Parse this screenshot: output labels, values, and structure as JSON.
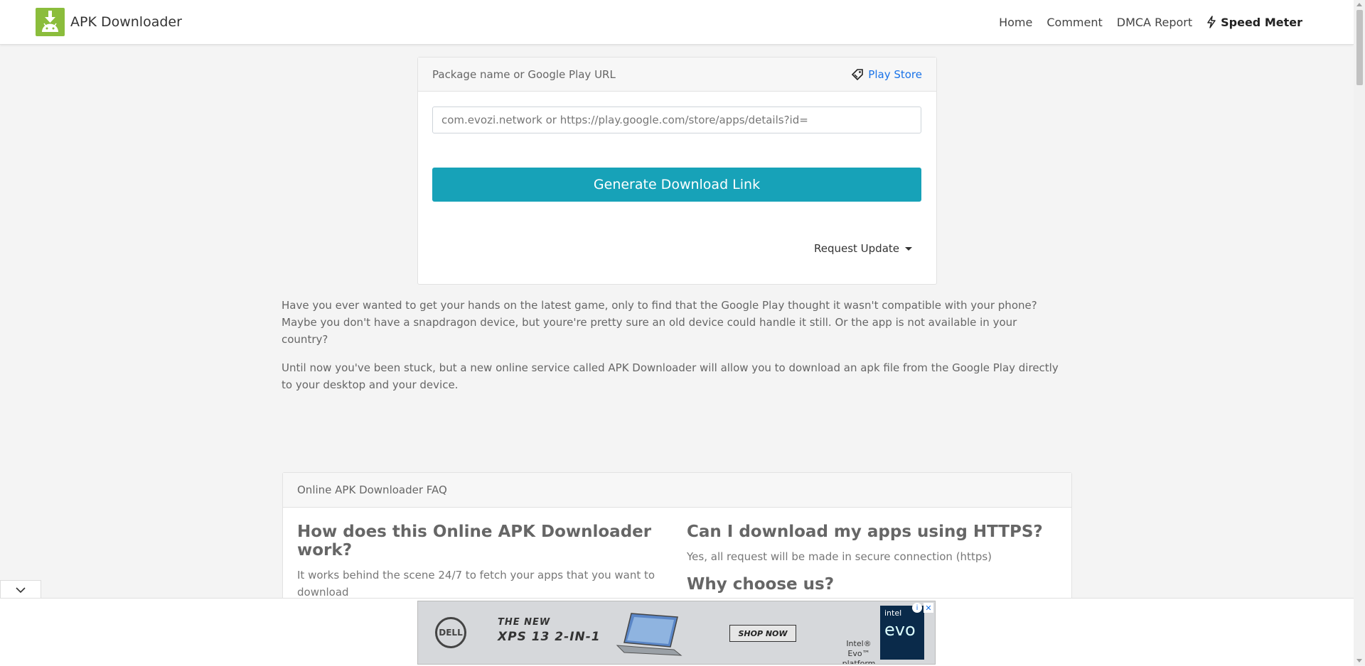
{
  "navbar": {
    "brand": "APK Downloader",
    "links": [
      "Home",
      "Comment",
      "DMCA Report"
    ],
    "speed_meter": "Speed Meter"
  },
  "card": {
    "header_title": "Package name or Google Play URL",
    "playstore_link": "Play Store",
    "input_placeholder": "com.evozi.network or https://play.google.com/store/apps/details?id=",
    "generate_button": "Generate Download Link",
    "request_update": "Request Update"
  },
  "intro": {
    "p1_line1": "Have you ever wanted to get your hands on the latest game, only to find that the Google Play thought it wasn't compatible with your phone?",
    "p1_line2": "Maybe you don't have a snapdragon device, but youre're pretty sure an old device could handle it still. Or the app is not available in your country?",
    "p2": "Until now you've been stuck, but a new online service called APK Downloader will allow you to download an apk file from the Google Play directly to your desktop and your device."
  },
  "faq": {
    "header": "Online APK Downloader FAQ",
    "items": [
      {
        "q": "How does this Online APK Downloader work?",
        "a": "It works behind the scene 24/7 to fetch your apps that you want to download"
      },
      {
        "q": "Can I download my apps using HTTPS?",
        "a": "Yes, all request will be made in secure connection (https)"
      },
      {
        "q": "Why choose us?",
        "a": ""
      }
    ]
  },
  "ad": {
    "brand": "DELL",
    "line1": "THE NEW",
    "line2": "XPS 13 2-IN-1",
    "cta": "SHOP NOW",
    "intel_text": "Intel® Evo™ platform",
    "badge_intel": "intel",
    "badge_evo": "evo"
  },
  "colors": {
    "primary_button": "#17a2b8",
    "link": "#1a73e8",
    "brand_logo": "#8bbd3c"
  }
}
